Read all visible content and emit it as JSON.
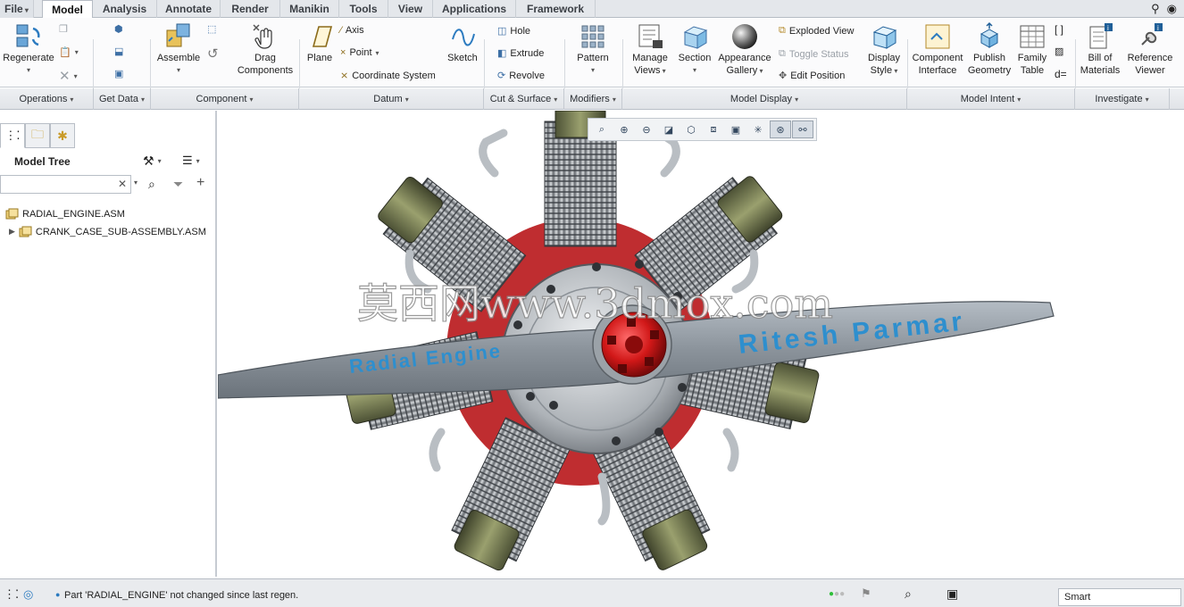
{
  "menu": {
    "tabs": [
      "File",
      "Model",
      "Analysis",
      "Annotate",
      "Render",
      "Manikin",
      "Tools",
      "View",
      "Applications",
      "Framework"
    ],
    "active_tab": "Model"
  },
  "ribbon": {
    "operations": {
      "regenerate": "Regenerate"
    },
    "component": {
      "assemble": "Assemble",
      "drag_line1": "Drag",
      "drag_line2": "Components"
    },
    "datum": {
      "plane": "Plane",
      "axis": "Axis",
      "point": "Point",
      "coordinate_system": "Coordinate System",
      "sketch": "Sketch"
    },
    "cut_surface": {
      "hole": "Hole",
      "extrude": "Extrude",
      "revolve": "Revolve"
    },
    "modifiers": {
      "pattern": "Pattern"
    },
    "model_display": {
      "manage_line1": "Manage",
      "manage_line2": "Views",
      "section": "Section",
      "appearance_line1": "Appearance",
      "appearance_line2": "Gallery",
      "exploded_view": "Exploded View",
      "toggle_status": "Toggle Status",
      "edit_position": "Edit Position",
      "display_line1": "Display",
      "display_line2": "Style"
    },
    "model_intent": {
      "component_line1": "Component",
      "component_line2": "Interface",
      "publish_line1": "Publish",
      "publish_line2": "Geometry",
      "family_line1": "Family",
      "family_line2": "Table"
    },
    "investigate": {
      "bom_line1": "Bill of",
      "bom_line2": "Materials",
      "ref_line1": "Reference",
      "ref_line2": "Viewer"
    }
  },
  "groups": [
    "Operations",
    "Get Data",
    "Component",
    "Datum",
    "Cut & Surface",
    "Modifiers",
    "Model Display",
    "Model Intent",
    "Investigate"
  ],
  "model_tree": {
    "title": "Model Tree",
    "search_value": "",
    "items": [
      "RADIAL_ENGINE.ASM",
      "CRANK_CASE_SUB-ASSEMBLY.ASM"
    ]
  },
  "graphics": {
    "watermark": "莫西网www.3dmox.com",
    "propeller_left_text": "Radial Engine",
    "propeller_right_text": "Ritesh Parmar",
    "accent_color": "#2e8fce"
  },
  "status": {
    "message": "Part 'RADIAL_ENGINE' not changed since last regen.",
    "selection_filter": "Smart"
  }
}
